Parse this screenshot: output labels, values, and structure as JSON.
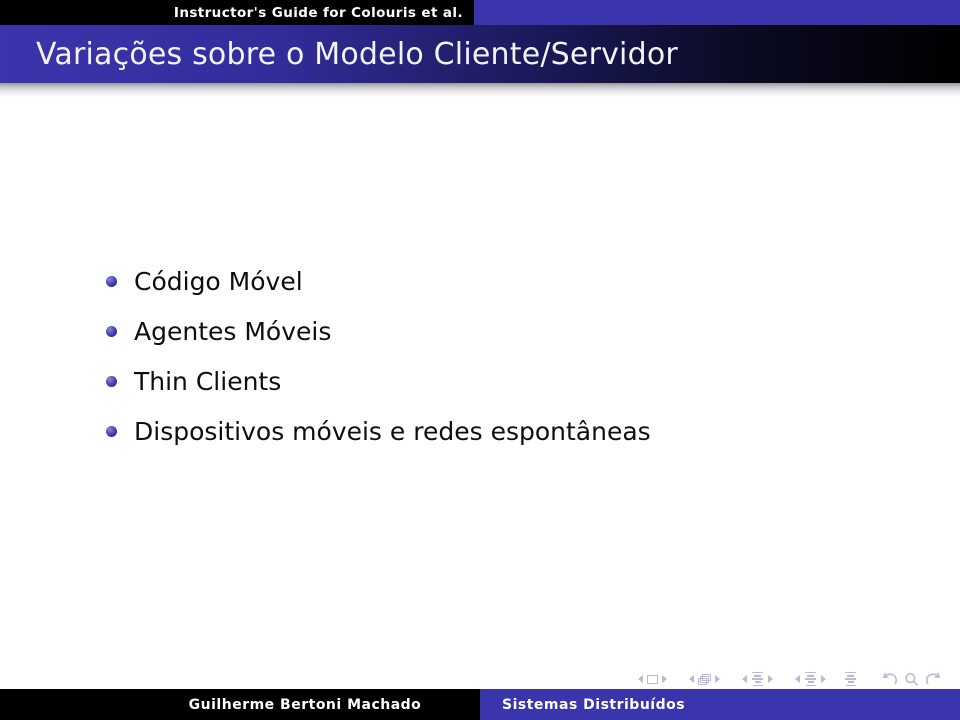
{
  "slide": {
    "headline_bar": {
      "text": "Instructor's Guide for Colouris et al.",
      "black_color": "#000000",
      "blue_color": "#3b35ad"
    },
    "title": "Variações sobre o Modelo Cliente/Servidor",
    "bullets": [
      {
        "text": "Código Móvel"
      },
      {
        "text": "Agentes Móveis"
      },
      {
        "text": "Thin Clients"
      },
      {
        "text": "Dispositivos móveis e redes espontâneas"
      }
    ],
    "nav_symbols": [
      {
        "name": "slide-navigation",
        "icon": "slide-icon"
      },
      {
        "name": "frame-navigation",
        "icon": "frame-icon"
      },
      {
        "name": "subsection-navigation",
        "icon": "subsection-icon"
      },
      {
        "name": "section-navigation",
        "icon": "section-icon"
      },
      {
        "name": "document-navigation",
        "icon": "document-icon"
      },
      {
        "name": "back-navigation",
        "icon": "back-arrow-icon"
      },
      {
        "name": "search-navigation",
        "icon": "magnifier-icon"
      },
      {
        "name": "forward-navigation",
        "icon": "forward-arrow-icon"
      }
    ],
    "footer": {
      "author": "Guilherme Bertoni Machado",
      "subject": "Sistemas Distribuídos"
    },
    "colors": {
      "accent_blue": "#3b35ad",
      "bullet_blue": "#4f4cbb",
      "text_black": "#0e0e0e",
      "nav_gray": "#b9b9d8"
    }
  }
}
